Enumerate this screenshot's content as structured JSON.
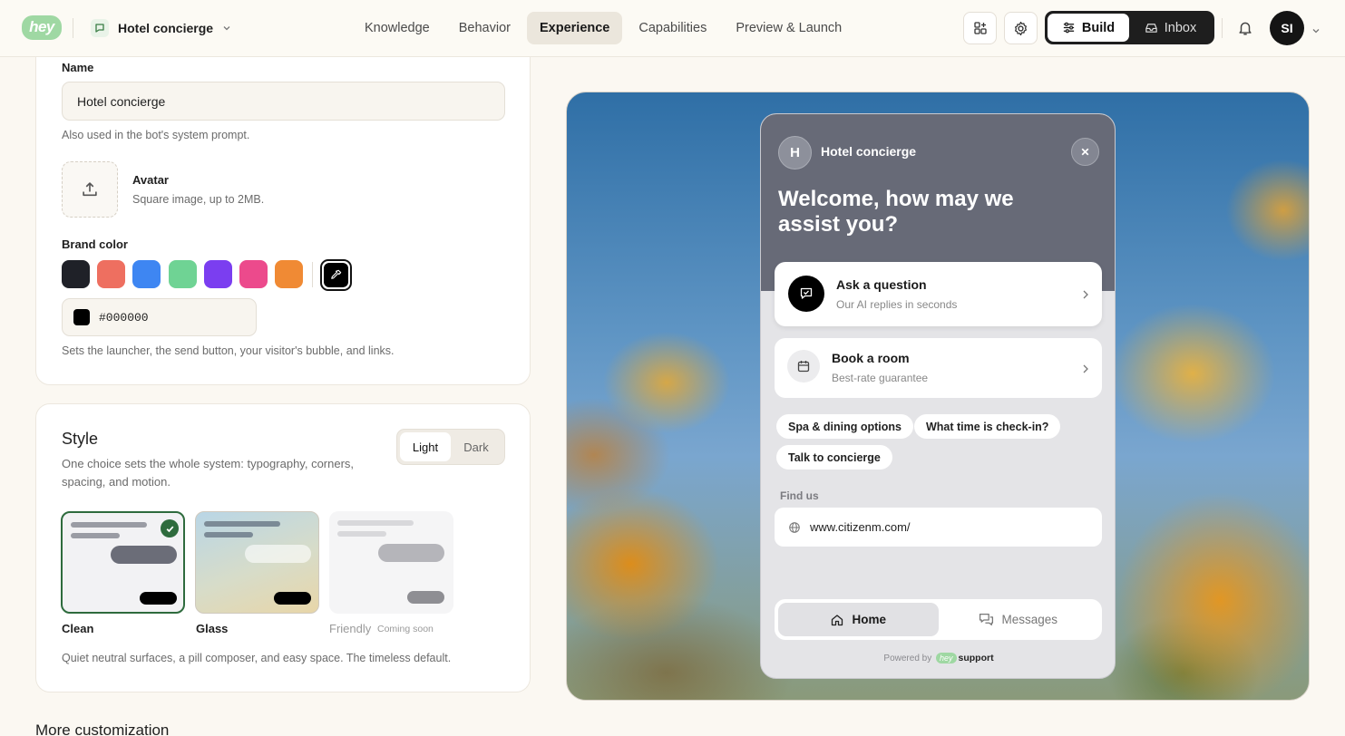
{
  "header": {
    "logo": "hey",
    "bot_name": "Hotel concierge",
    "tabs": [
      {
        "label": "Knowledge"
      },
      {
        "label": "Behavior"
      },
      {
        "label": "Experience",
        "active": true
      },
      {
        "label": "Capabilities"
      },
      {
        "label": "Preview & Launch"
      }
    ],
    "build_label": "Build",
    "inbox_label": "Inbox",
    "user_initials": "SI"
  },
  "identity": {
    "name_label": "Name",
    "name_value": "Hotel concierge",
    "name_hint": "Also used in the bot's system prompt.",
    "avatar_label": "Avatar",
    "avatar_hint": "Square image, up to 2MB.",
    "brand_label": "Brand color",
    "swatches": [
      "#1f2128",
      "#ee6f60",
      "#3e86f2",
      "#6fd394",
      "#7b3ef0",
      "#ec4a8c",
      "#f08a34"
    ],
    "selected_color": "#000000",
    "brand_hint": "Sets the launcher, the send button, your visitor's bubble, and links."
  },
  "style": {
    "title": "Style",
    "description": "One choice sets the whole system: typography, corners, spacing, and motion.",
    "theme_options": [
      {
        "label": "Light",
        "active": true
      },
      {
        "label": "Dark"
      }
    ],
    "options": [
      {
        "name": "Clean",
        "selected": true
      },
      {
        "name": "Glass"
      },
      {
        "name": "Friendly",
        "badge": "Coming soon"
      }
    ],
    "footer": "Quiet neutral surfaces, a pill composer, and easy space. The timeless default."
  },
  "more_title": "More customization",
  "widget": {
    "avatar_letter": "H",
    "bot_name": "Hotel concierge",
    "welcome": "Welcome, how may we assist you?",
    "actions": [
      {
        "title": "Ask a question",
        "subtitle": "Our AI replies in seconds"
      },
      {
        "title": "Book a room",
        "subtitle": "Best-rate guarantee"
      }
    ],
    "chips": [
      "Spa & dining options",
      "What time is check-in?",
      "Talk to concierge"
    ],
    "find_us_label": "Find us",
    "url": "www.citizenm.com/",
    "nav": [
      {
        "label": "Home",
        "active": true
      },
      {
        "label": "Messages"
      }
    ],
    "powered_prefix": "Powered by",
    "powered_logo": "hey",
    "powered_brand": "support"
  }
}
